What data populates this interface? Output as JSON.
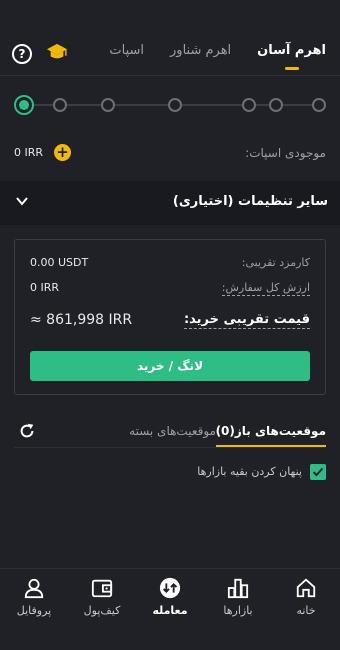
{
  "header": {
    "tabs": [
      {
        "label": "اسپات",
        "active": false
      },
      {
        "label": "اهرم شناور",
        "active": false
      },
      {
        "label": "اهرم آسان",
        "active": true
      }
    ],
    "help_glyph": "?",
    "icons": [
      "help-icon",
      "graduation-cap-icon"
    ]
  },
  "leverage_slider": {
    "steps": 7,
    "selected_index": 0
  },
  "balance": {
    "label": "موجودی اسپات:",
    "value": "0 IRR",
    "add_glyph": "+"
  },
  "settings": {
    "label": "سایر تنظیمات (اختیاری)",
    "icon": "chevron-down-icon"
  },
  "order": {
    "fee_label": "کارمزد تقریبی:",
    "fee_value": "0.00 USDT",
    "total_label": "ارزش کل سفارش:",
    "total_value": "0 IRR",
    "price_label": "قیمت تقریبی خرید:",
    "price_value": "≈  861,998  IRR",
    "buy_button": "لانگ / خرید"
  },
  "positions": {
    "open_tab": "موقعیت‌های باز(0)",
    "closed_tab": "موقعیت‌های بسته",
    "hide_others_label": "پنهان کردن بقیه بازارها",
    "hide_others_checked": true
  },
  "bottom_nav": [
    {
      "label": "خانه",
      "icon": "home-icon",
      "active": false
    },
    {
      "label": "بازارها",
      "icon": "markets-chart-icon",
      "active": false
    },
    {
      "label": "معامله",
      "icon": "trade-swap-icon",
      "active": true
    },
    {
      "label": "کیف‌پول",
      "icon": "wallet-icon",
      "active": false
    },
    {
      "label": "پروفایل",
      "icon": "profile-icon",
      "active": false
    }
  ],
  "colors": {
    "background": "#1f2126",
    "accent_green": "#2ebd85",
    "accent_yellow": "#f0b90b"
  }
}
